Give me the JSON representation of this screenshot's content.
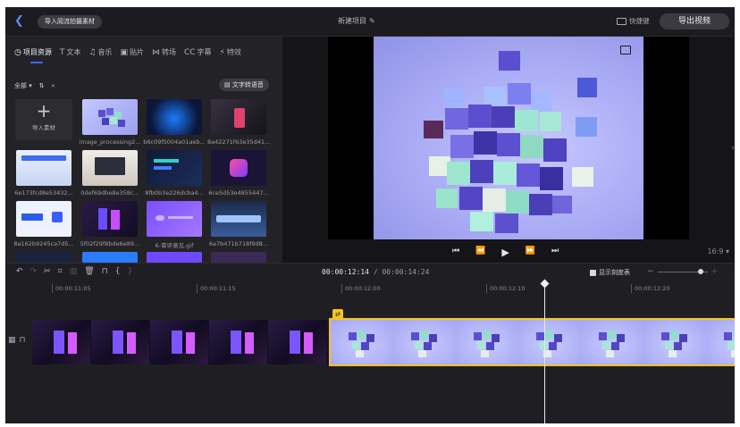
{
  "header": {
    "import_button": "导入阅流拍摄素材",
    "project_title": "新建项目",
    "shortcut_label": "快捷键",
    "export_button": "导出视频"
  },
  "tabs": [
    {
      "icon": "project-resources-icon",
      "label": "项目资源"
    },
    {
      "icon": "text-icon",
      "label": "文本"
    },
    {
      "icon": "music-icon",
      "label": "音乐"
    },
    {
      "icon": "sticker-icon",
      "label": "贴片"
    },
    {
      "icon": "transition-icon",
      "label": "转场"
    },
    {
      "icon": "captions-icon",
      "label": "字幕"
    },
    {
      "icon": "effects-icon",
      "label": "特效"
    }
  ],
  "filter": {
    "all_label": "全部"
  },
  "tts_button": "文字转语音",
  "media": {
    "import_tile": "导入素材",
    "items": [
      {
        "caption": "image_processing2..."
      },
      {
        "caption": "b6c09f5004a01aeb..."
      },
      {
        "caption": "8a42271f63e35d41..."
      },
      {
        "caption": "6e173fcd8e53432..."
      },
      {
        "caption": "0def69dbe8e358c..."
      },
      {
        "caption": "8fb0b3e226dcba4..."
      },
      {
        "caption": "6ce5d53e4855447..."
      },
      {
        "caption": "8a162b9245ca7d5..."
      },
      {
        "caption": "5f02f29f8bde6e89..."
      },
      {
        "caption": "6-审评意见.gif"
      },
      {
        "caption": "6a7b471b718f9d8..."
      }
    ]
  },
  "preview": {
    "ratio": "16:9"
  },
  "timeline": {
    "current_time": "00:00:12:14",
    "total_time": "00:00:14:24",
    "show_scale_label": "显示刻度表",
    "ruler": [
      "00:00:11:05",
      "00:00:11:15",
      "00:00:12:00",
      "00:00:12:10",
      "00:00:12:20"
    ]
  },
  "colors": {
    "accent": "#3c6dff",
    "selection": "#f3c41e",
    "background": "#1f1f23"
  }
}
